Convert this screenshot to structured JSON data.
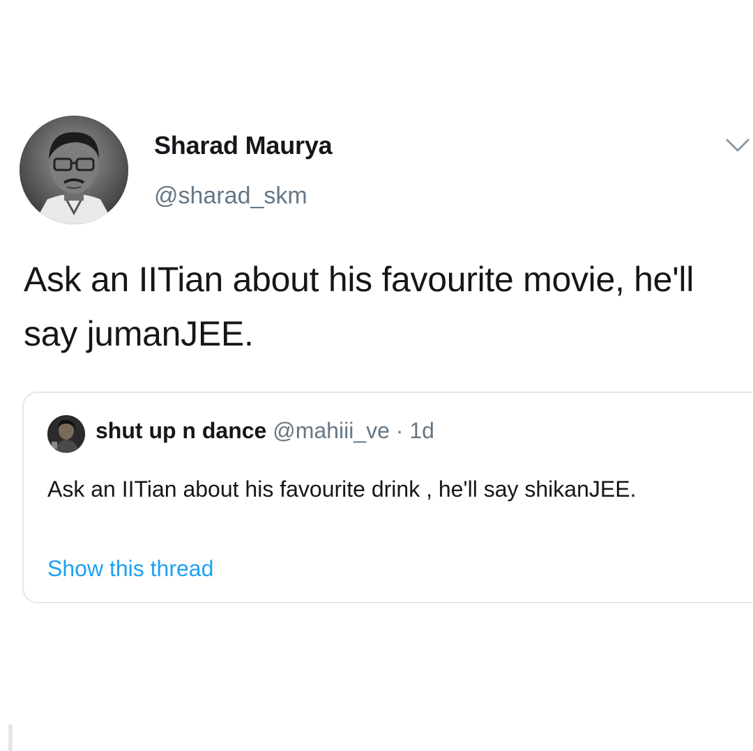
{
  "tweet": {
    "author": {
      "display_name": "Sharad Maurya",
      "handle": "@sharad_skm",
      "avatar_icon": "profile-photo"
    },
    "text": "Ask an IITian about his favourite movie, he'll say jumanJEE.",
    "menu_icon": "chevron-down-icon"
  },
  "quoted_tweet": {
    "author": {
      "display_name": "shut up n dance",
      "handle": "@mahiii_ve",
      "separator": "·",
      "time": "1d",
      "avatar_icon": "profile-photo"
    },
    "text": "Ask an IITian about his favourite drink , he'll say shikanJEE.",
    "show_thread_label": "Show this thread"
  },
  "colors": {
    "text_primary": "#14171a",
    "text_secondary": "#657786",
    "link": "#1da1f2",
    "border": "#e1e8ed",
    "background": "#ffffff"
  }
}
